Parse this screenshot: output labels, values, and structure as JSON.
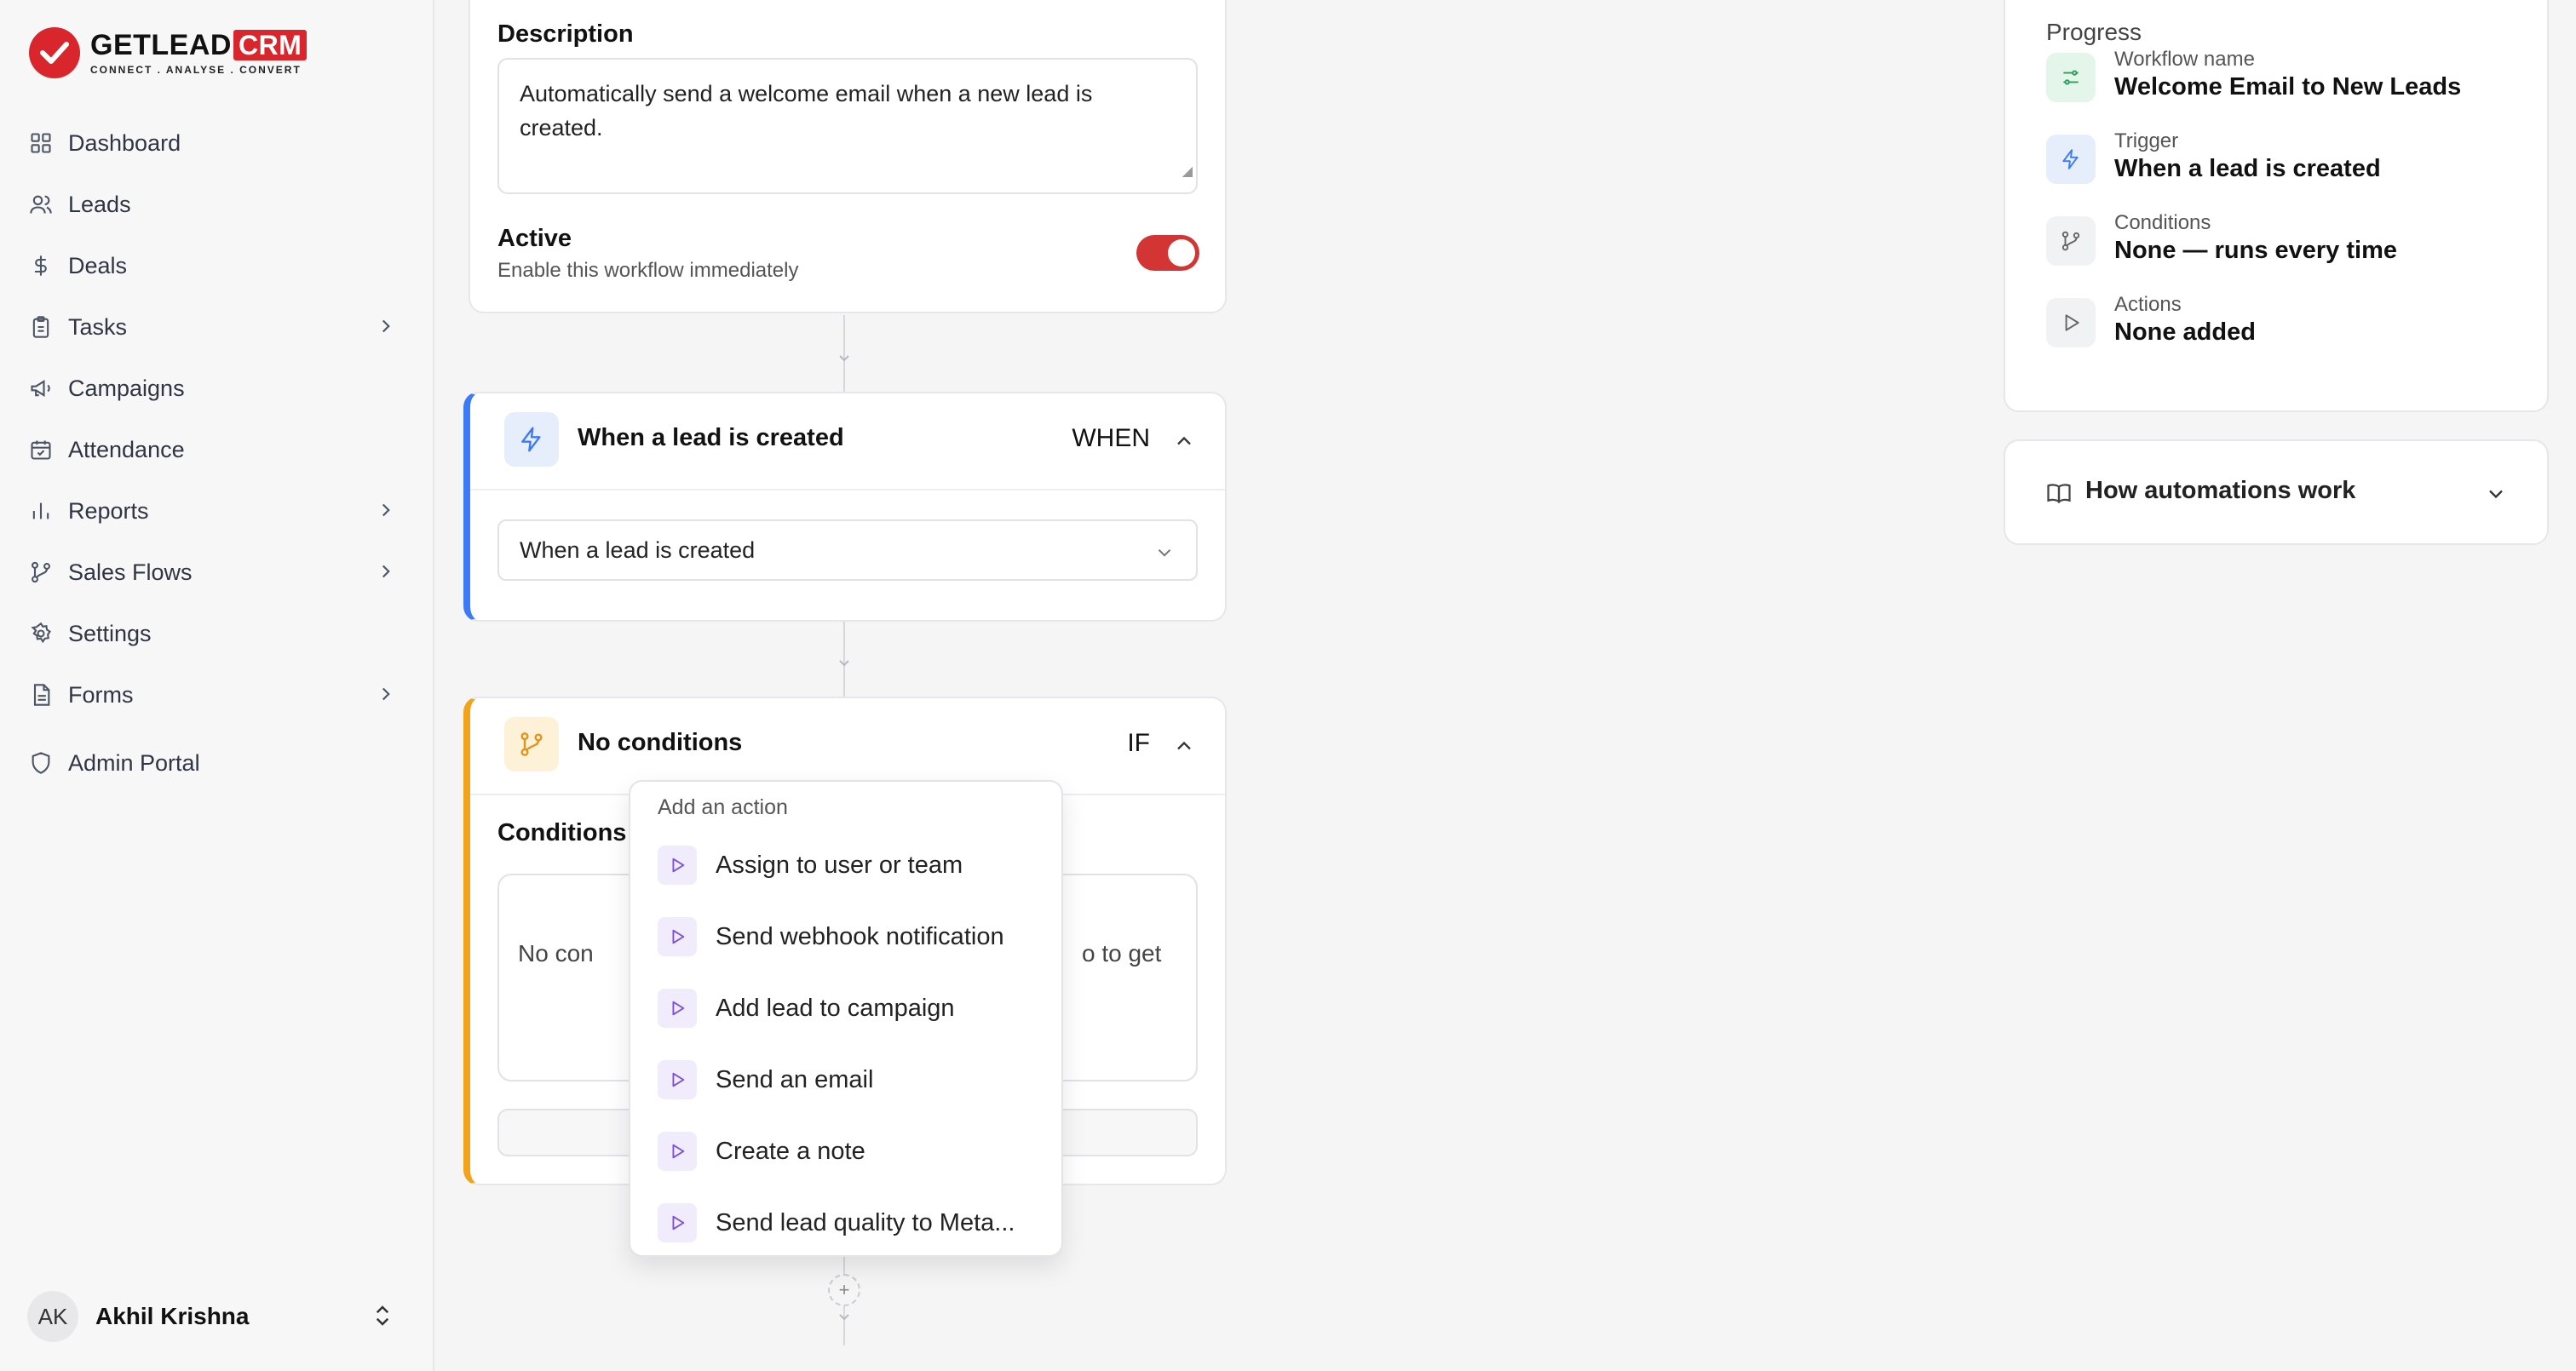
{
  "brand": {
    "name": "GETLEAD",
    "suffix": "CRM",
    "tagline": "CONNECT . ANALYSE . CONVERT"
  },
  "sidebar": {
    "items": [
      {
        "label": "Dashboard",
        "icon": "grid-icon"
      },
      {
        "label": "Leads",
        "icon": "users-icon"
      },
      {
        "label": "Deals",
        "icon": "dollar-icon"
      },
      {
        "label": "Tasks",
        "icon": "clipboard-icon",
        "has_children": true
      },
      {
        "label": "Campaigns",
        "icon": "megaphone-icon"
      },
      {
        "label": "Attendance",
        "icon": "calendar-check-icon"
      },
      {
        "label": "Reports",
        "icon": "bar-chart-icon",
        "has_children": true
      },
      {
        "label": "Sales Flows",
        "icon": "git-branch-icon",
        "has_children": true
      },
      {
        "label": "Settings",
        "icon": "gear-icon"
      },
      {
        "label": "Forms",
        "icon": "file-icon",
        "has_children": true
      }
    ],
    "admin": {
      "label": "Admin Portal",
      "icon": "shield-icon"
    },
    "user": {
      "initials": "AK",
      "name": "Akhil Krishna"
    }
  },
  "details": {
    "description_label": "Description",
    "description_value": "Automatically send a welcome email when a new lead is created.",
    "active_label": "Active",
    "active_sub": "Enable this workflow immediately",
    "active_on": true
  },
  "trigger_step": {
    "title": "When a lead is created",
    "tag": "WHEN",
    "selected": "When a lead is created",
    "accent": "#3b7cf6"
  },
  "condition_step": {
    "title": "No conditions",
    "tag": "IF",
    "section_label": "Conditions",
    "empty_text_left": "No con",
    "empty_text_right": "o to get",
    "accent": "#f3a31a"
  },
  "action_menu": {
    "heading": "Add an action",
    "items": [
      "Assign to user or team",
      "Send webhook notification",
      "Add lead to campaign",
      "Send an email",
      "Create a note",
      "Send lead quality to Meta..."
    ]
  },
  "progress": {
    "title": "Progress",
    "rows": [
      {
        "label": "Workflow name",
        "value": "Welcome Email to New Leads",
        "icon": "sliders-icon",
        "bg": "#e4f6ea",
        "fg": "#2e9e5b"
      },
      {
        "label": "Trigger",
        "value": "When a lead is created",
        "icon": "bolt-icon",
        "bg": "#e6eefc",
        "fg": "#3b7cf6"
      },
      {
        "label": "Conditions",
        "value": "None — runs every time",
        "icon": "branch-icon",
        "bg": "#f1f2f4",
        "fg": "#666"
      },
      {
        "label": "Actions",
        "value": "None added",
        "icon": "play-icon",
        "bg": "#f1f2f4",
        "fg": "#666"
      }
    ]
  },
  "help": {
    "label": "How automations work"
  }
}
